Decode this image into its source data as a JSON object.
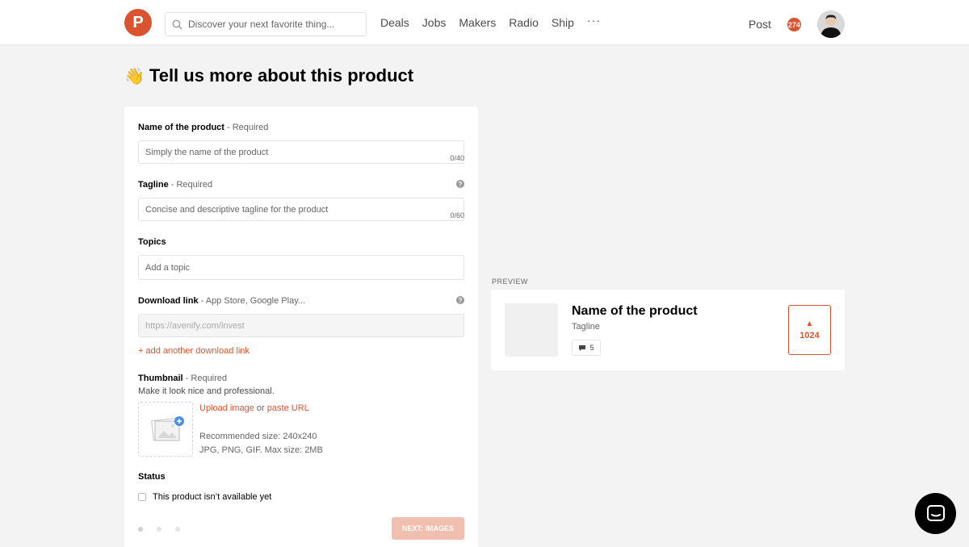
{
  "header": {
    "logo_letter": "P",
    "search_placeholder": "Discover your next favorite thing...",
    "nav": [
      "Deals",
      "Jobs",
      "Makers",
      "Radio",
      "Ship"
    ],
    "more": "···",
    "post": "Post",
    "notifications": "274"
  },
  "page": {
    "emoji": "👋",
    "title": "Tell us more about this product"
  },
  "form": {
    "name": {
      "label": "Name of the product",
      "req": " - Required",
      "placeholder": "Simply the name of the product",
      "counter": "0/40"
    },
    "tagline": {
      "label": "Tagline",
      "req": " - Required",
      "placeholder": "Concise and descriptive tagline for the product",
      "counter": "0/60"
    },
    "topics": {
      "label": "Topics",
      "placeholder": "Add a topic"
    },
    "download": {
      "label": "Download link",
      "req": " - App Store, Google Play...",
      "placeholder": "https://avenify.com/invest",
      "add_link": "+ add another download link"
    },
    "thumbnail": {
      "label": "Thumbnail",
      "req": " - Required",
      "subtitle": "Make it look nice and professional.",
      "upload": "Upload image",
      "or": " or ",
      "paste": "paste URL",
      "recommended": "Recommended size: 240x240",
      "formats": "JPG, PNG, GIF. Max size: 2MB"
    },
    "status": {
      "label": "Status",
      "checkbox": "This product isn’t available yet"
    },
    "next_button": "NEXT: IMAGES",
    "help": "?"
  },
  "preview": {
    "label": "PREVIEW",
    "name": "Name of the product",
    "tagline": "Tagline",
    "comments": "5",
    "votes": "1024",
    "vote_arrow": "▲"
  },
  "colors": {
    "brand": "#da552f"
  }
}
